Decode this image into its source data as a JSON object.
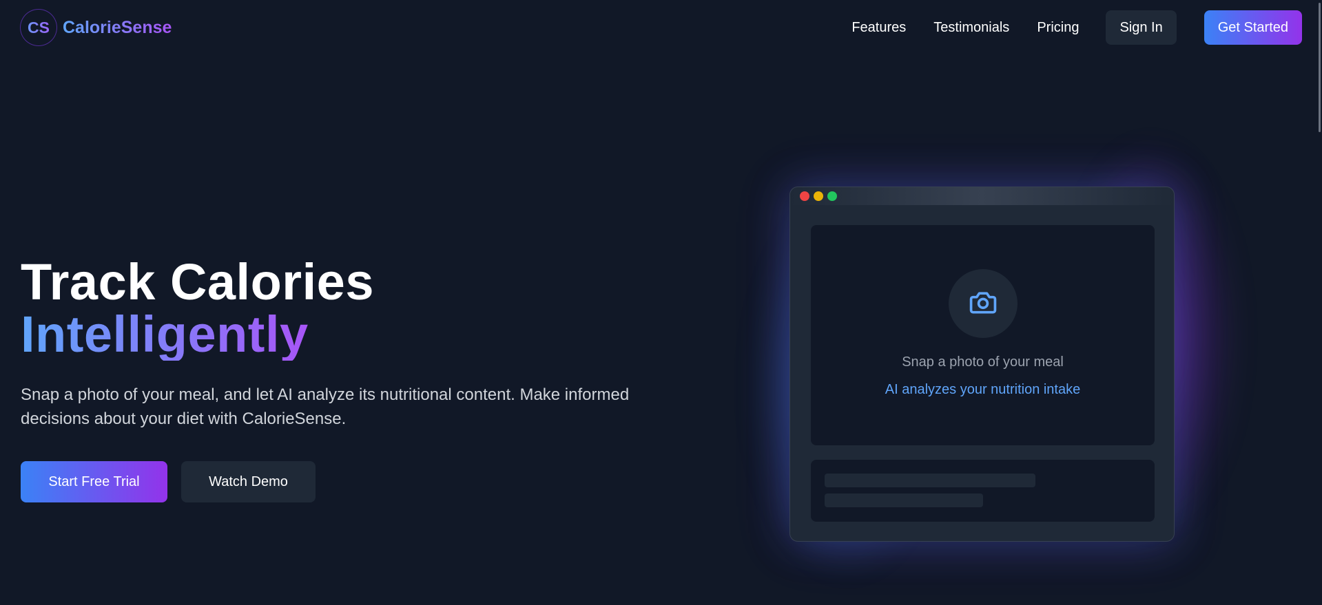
{
  "brand": {
    "logo_text": "CS",
    "name": "CalorieSense"
  },
  "nav": {
    "links": [
      {
        "label": "Features"
      },
      {
        "label": "Testimonials"
      },
      {
        "label": "Pricing"
      }
    ],
    "sign_in_label": "Sign In",
    "get_started_label": "Get Started"
  },
  "hero": {
    "title_line1": "Track Calories",
    "title_line2": "Intelligently",
    "description": "Snap a photo of your meal, and let AI analyze its nutritional content. Make informed decisions about your diet with CalorieSense.",
    "primary_button": "Start Free Trial",
    "secondary_button": "Watch Demo"
  },
  "mockup": {
    "snap_text": "Snap a photo of your meal",
    "ai_text": "AI analyzes your nutrition intake",
    "icon": "camera-icon"
  },
  "colors": {
    "background": "#111827",
    "surface": "#1f2937",
    "accent_blue": "#3b82f6",
    "accent_purple": "#9333ea",
    "link_blue": "#60a5fa"
  }
}
